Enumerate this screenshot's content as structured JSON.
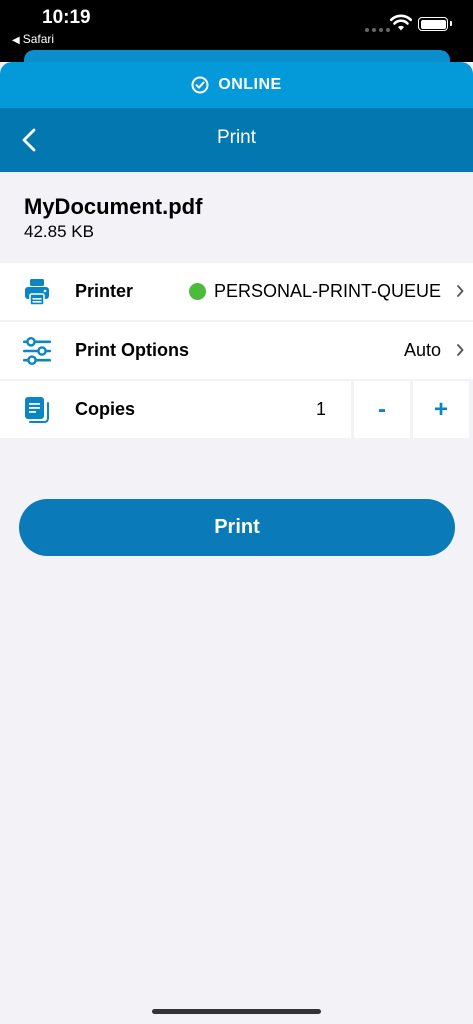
{
  "status_bar": {
    "time": "10:19",
    "back_app": "Safari"
  },
  "connection": {
    "status": "ONLINE",
    "icon": "check-circle-icon"
  },
  "nav": {
    "title": "Print",
    "back_icon": "chevron-left-icon"
  },
  "document": {
    "name": "MyDocument.pdf",
    "size": "42.85 KB"
  },
  "settings": {
    "printer": {
      "label": "Printer",
      "value": "PERSONAL-PRINT-QUEUE",
      "status_color": "#4cbb3c",
      "icon": "printer-icon"
    },
    "print_options": {
      "label": "Print Options",
      "value": "Auto",
      "icon": "sliders-icon"
    },
    "copies": {
      "label": "Copies",
      "value": "1",
      "decrement_label": "-",
      "increment_label": "+",
      "icon": "copies-icon"
    }
  },
  "actions": {
    "print_label": "Print"
  },
  "colors": {
    "online_bar": "#0499d8",
    "nav_bar": "#0377b0",
    "accent": "#0a7ab8",
    "background": "#f2f2f7"
  }
}
